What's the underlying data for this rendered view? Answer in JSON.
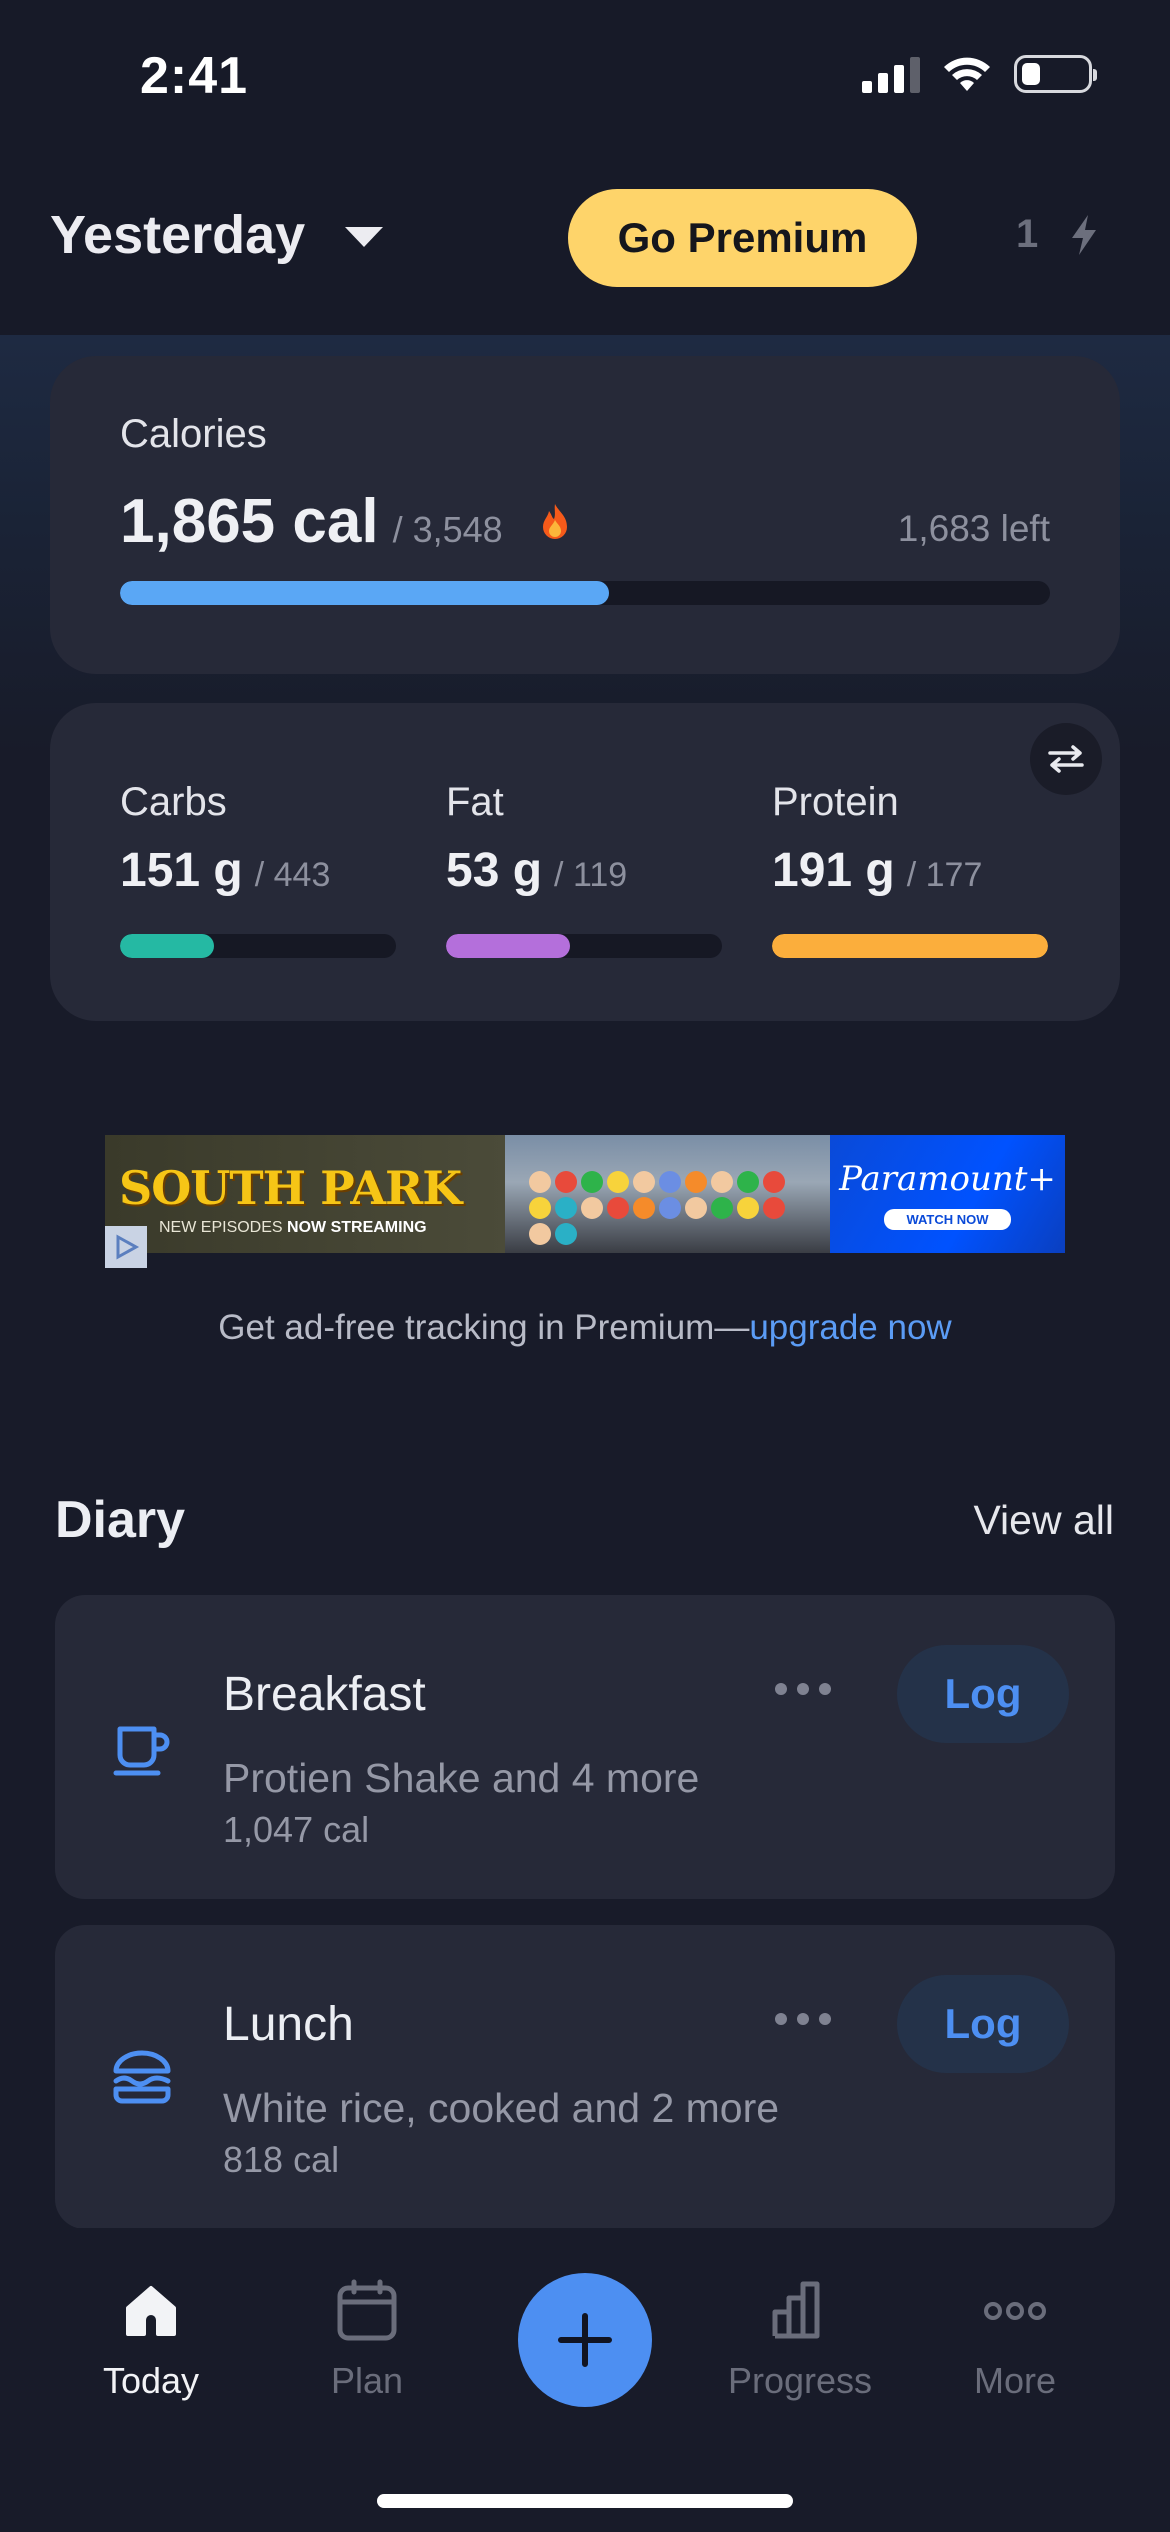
{
  "status": {
    "time": "2:41"
  },
  "header": {
    "date_label": "Yesterday",
    "premium_label": "Go Premium",
    "streak_count": "1"
  },
  "calories": {
    "title": "Calories",
    "value": "1,865 cal",
    "goal": "/ 3,548",
    "left": "1,683 left",
    "progress": 0.526,
    "color": "#5aa7f5"
  },
  "macros": [
    {
      "name": "Carbs",
      "value": "151 g",
      "goal": "/ 443",
      "progress": 0.34,
      "color": "#25b9a3"
    },
    {
      "name": "Fat",
      "value": "53 g",
      "goal": "/ 119",
      "progress": 0.45,
      "color": "#b46fdb"
    },
    {
      "name": "Protein",
      "value": "191 g",
      "goal": "/ 177",
      "progress": 1.0,
      "color": "#fbae3c"
    }
  ],
  "ad": {
    "title": "SOUTH PARK",
    "subtitle_prefix": "NEW EPISODES ",
    "subtitle_bold": "NOW STREAMING",
    "brand": "Paramount+",
    "cta": "WATCH NOW",
    "caption": "Get ad-free tracking in Premium—",
    "caption_link": "upgrade now"
  },
  "diary": {
    "title": "Diary",
    "view_all": "View all",
    "meals": [
      {
        "name": "Breakfast",
        "items": "Protien Shake and 4 more",
        "cal": "1,047 cal",
        "log_label": "Log",
        "icon": "coffee-cup-icon"
      },
      {
        "name": "Lunch",
        "items": "White rice, cooked and 2 more",
        "cal": "818 cal",
        "log_label": "Log",
        "icon": "burger-icon"
      }
    ]
  },
  "tabs": [
    {
      "label": "Today",
      "icon": "home-icon",
      "active": true
    },
    {
      "label": "Plan",
      "icon": "calendar-icon",
      "active": false
    },
    {
      "label": "Progress",
      "icon": "bar-chart-icon",
      "active": false
    },
    {
      "label": "More",
      "icon": "more-dots-icon",
      "active": false
    }
  ],
  "colors": {
    "accent": "#4d8ff2",
    "premium": "#fed46a",
    "card": "#262938",
    "background": "#181b29"
  }
}
